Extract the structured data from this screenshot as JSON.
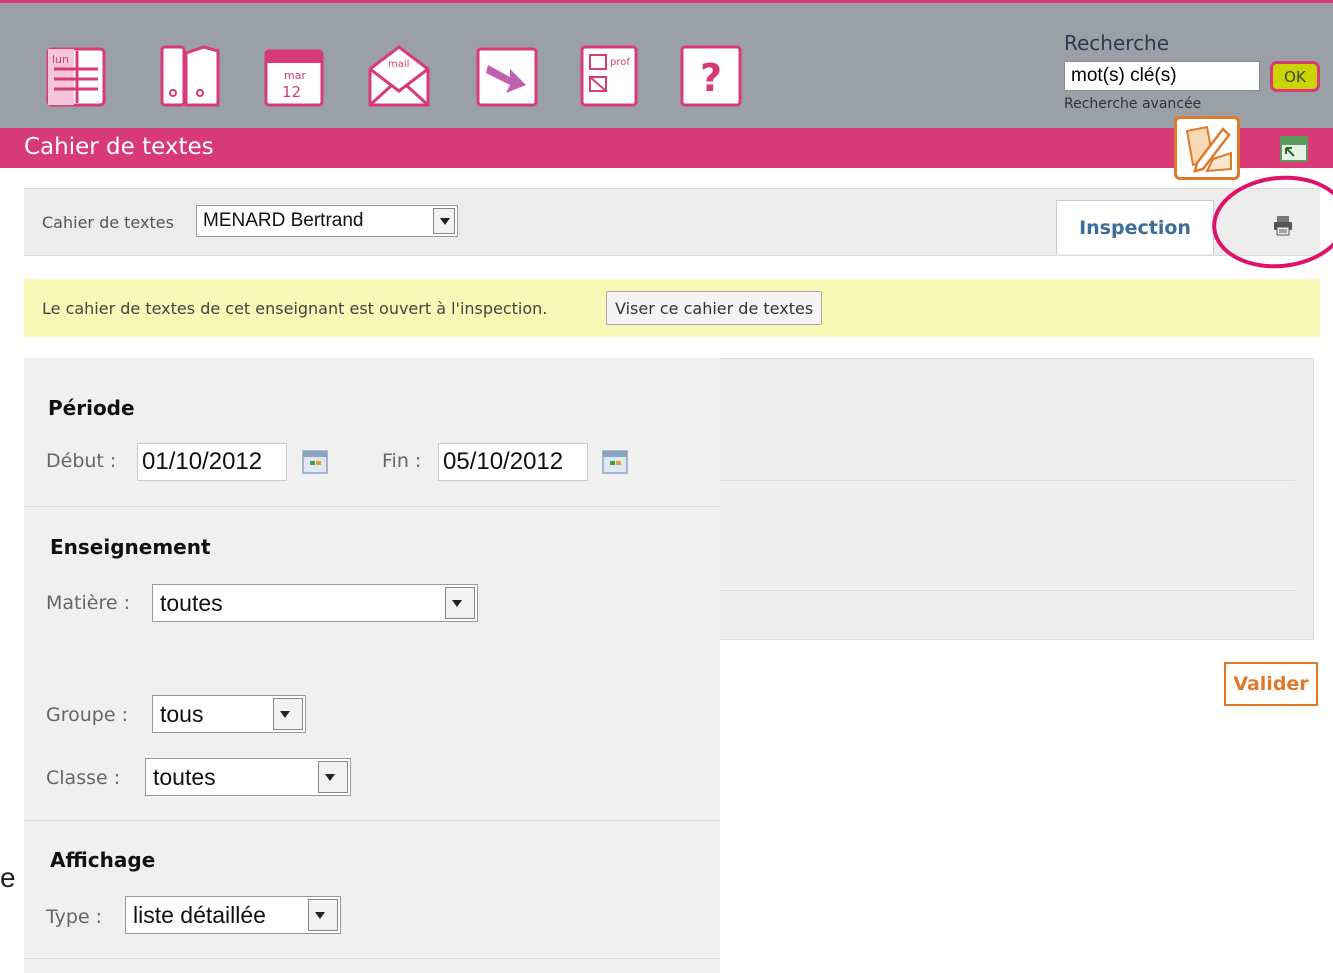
{
  "toolbar": {
    "icons": [
      {
        "name": "agenda-icon",
        "label": "lun"
      },
      {
        "name": "binders-icon",
        "label": ""
      },
      {
        "name": "calendar-icon",
        "label_top": "mar",
        "label_num": "12"
      },
      {
        "name": "mail-icon",
        "label": "mail"
      },
      {
        "name": "inbox-arrow-icon",
        "label": ""
      },
      {
        "name": "prof-form-icon",
        "label": "prof"
      },
      {
        "name": "help-icon",
        "label": "?"
      }
    ]
  },
  "search": {
    "title": "Recherche",
    "value": "mot(s) clé(s)",
    "ok_label": "OK",
    "advanced_label": "Recherche avancée"
  },
  "header": {
    "title": "Cahier de textes"
  },
  "selector": {
    "label": "Cahier de textes",
    "value": "MENARD Bertrand",
    "tab_label": "Inspection"
  },
  "notice": {
    "text": "Le cahier de textes de cet enseignant est ouvert à l'inspection.",
    "button_label": "Viser ce cahier de textes"
  },
  "filters": {
    "periode": {
      "title": "Période",
      "debut_label": "Début :",
      "debut_value": "01/10/2012",
      "fin_label": "Fin :",
      "fin_value": "05/10/2012"
    },
    "enseignement": {
      "title": "Enseignement",
      "matiere_label": "Matière :",
      "matiere_value": "toutes",
      "groupe_label": "Groupe :",
      "groupe_value": "tous",
      "classe_label": "Classe :",
      "classe_value": "toutes"
    },
    "affichage": {
      "title": "Affichage",
      "type_label": "Type :",
      "type_value": "liste détaillée"
    }
  },
  "actions": {
    "valider_label": "Valider"
  },
  "misc": {
    "stray_letter": "e"
  },
  "colors": {
    "brand_pink": "#d83a78",
    "toolbar_gray": "#9aa0a6",
    "accent_orange": "#e07a2a",
    "notice_yellow": "#f9f8b6",
    "tab_blue": "#3a6e99"
  }
}
